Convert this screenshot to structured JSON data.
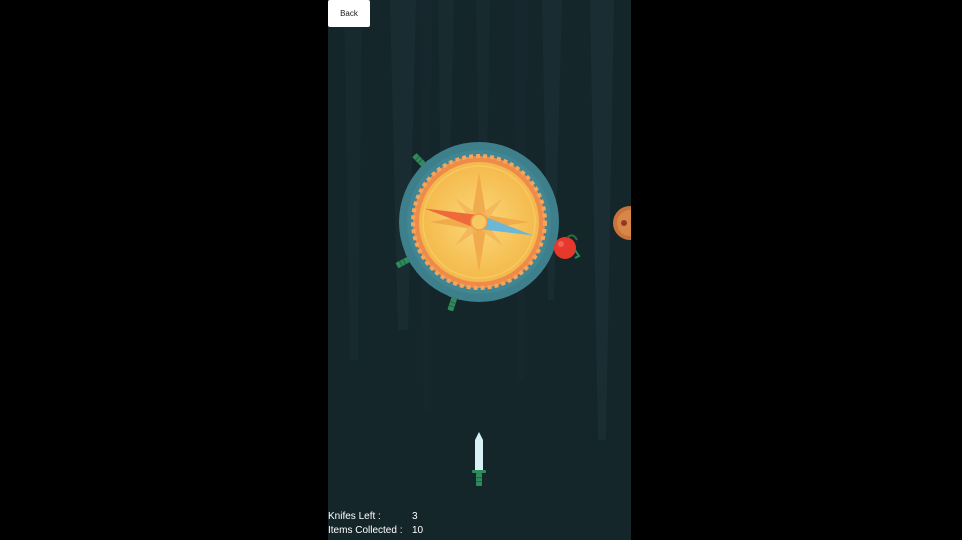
{
  "back_button": {
    "label": "Back"
  },
  "hud": {
    "knives_left": {
      "label": "Knifes Left :",
      "value": "3"
    },
    "items_collected": {
      "label": "Items Collected :",
      "value": "10"
    }
  },
  "colors": {
    "page_background": "#000000",
    "game_background": "#15262b",
    "target_ring": "#3e7f8c",
    "target_face": "#f7c861",
    "target_rim": "#ee8b4b",
    "needle_orange": "#ef6a3a",
    "needle_blue": "#6ab7d6",
    "knife_blade": "#d8f1f6",
    "knife_handle": "#2f8a5d",
    "apple": "#e8382b",
    "coin": "#c9733a"
  },
  "icons": {
    "target": "compass-target-icon",
    "knife": "knife-icon",
    "apple": "apple-icon",
    "coin": "coin-icon"
  }
}
